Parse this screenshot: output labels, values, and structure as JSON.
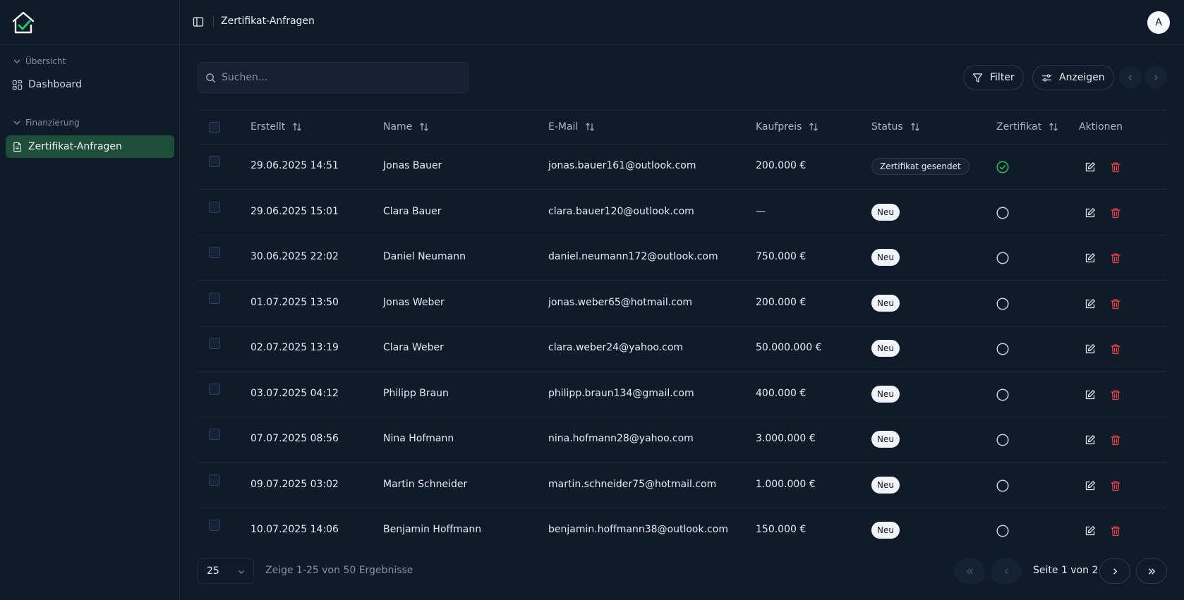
{
  "sidebar": {
    "groups": [
      {
        "label": "Übersicht",
        "items": [
          {
            "label": "Dashboard",
            "icon": "dashboard-grid-icon"
          }
        ]
      },
      {
        "label": "Finanzierung",
        "items": [
          {
            "label": "Zertifikat-Anfragen",
            "icon": "document-icon",
            "active": true
          }
        ]
      }
    ]
  },
  "topbar": {
    "title": "Zertifikat-Anfragen",
    "avatar_initial": "A"
  },
  "toolbar": {
    "search_placeholder": "Suchen...",
    "filter_label": "Filter",
    "view_label": "Anzeigen"
  },
  "table": {
    "columns": [
      "Erstellt",
      "Name",
      "E-Mail",
      "Kaufpreis",
      "Status",
      "Zertifikat",
      "Aktionen"
    ],
    "rows": [
      {
        "created": "29.06.2025 14:51",
        "name": "Jonas Bauer",
        "email": "jonas.bauer161@outlook.com",
        "price": "200.000 €",
        "status": "Zertifikat gesendet",
        "certificate": true
      },
      {
        "created": "29.06.2025 15:01",
        "name": "Clara Bauer",
        "email": "clara.bauer120@outlook.com",
        "price": "—",
        "status": "Neu",
        "certificate": false
      },
      {
        "created": "30.06.2025 22:02",
        "name": "Daniel Neumann",
        "email": "daniel.neumann172@outlook.com",
        "price": "750.000 €",
        "status": "Neu",
        "certificate": false
      },
      {
        "created": "01.07.2025 13:50",
        "name": "Jonas Weber",
        "email": "jonas.weber65@hotmail.com",
        "price": "200.000 €",
        "status": "Neu",
        "certificate": false
      },
      {
        "created": "02.07.2025 13:19",
        "name": "Clara Weber",
        "email": "clara.weber24@yahoo.com",
        "price": "50.000.000 €",
        "status": "Neu",
        "certificate": false
      },
      {
        "created": "03.07.2025 04:12",
        "name": "Philipp Braun",
        "email": "philipp.braun134@gmail.com",
        "price": "400.000 €",
        "status": "Neu",
        "certificate": false
      },
      {
        "created": "07.07.2025 08:56",
        "name": "Nina Hofmann",
        "email": "nina.hofmann28@yahoo.com",
        "price": "3.000.000 €",
        "status": "Neu",
        "certificate": false
      },
      {
        "created": "09.07.2025 03:02",
        "name": "Martin Schneider",
        "email": "martin.schneider75@hotmail.com",
        "price": "1.000.000 €",
        "status": "Neu",
        "certificate": false
      },
      {
        "created": "10.07.2025 14:06",
        "name": "Benjamin Hoffmann",
        "email": "benjamin.hoffmann38@outlook.com",
        "price": "150.000 €",
        "status": "Neu",
        "certificate": false
      }
    ]
  },
  "footer": {
    "page_size": "25",
    "results_text": "Zeige 1-25 von 50 Ergebnisse",
    "page_text": "Seite 1 von 2"
  },
  "colors": {
    "background": "#0f1b2b",
    "active_nav": "#1f4d3b",
    "success": "#22c55e",
    "danger": "#ef4444"
  }
}
